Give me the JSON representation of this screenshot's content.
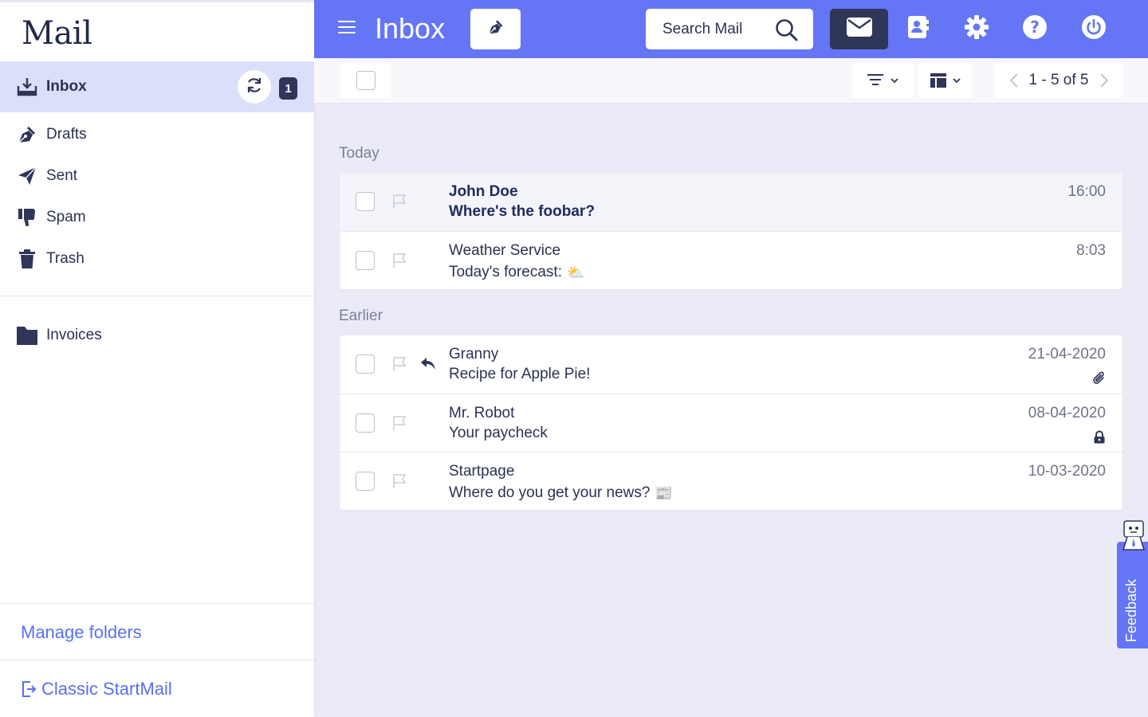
{
  "app": {
    "logo": "Mail"
  },
  "sidebar": {
    "items": [
      {
        "label": "Inbox",
        "icon": "inbox-icon",
        "unread": "1",
        "active": true
      },
      {
        "label": "Drafts",
        "icon": "drafts-pen-icon"
      },
      {
        "label": "Sent",
        "icon": "paper-plane-icon"
      },
      {
        "label": "Spam",
        "icon": "thumbs-down-icon"
      },
      {
        "label": "Trash",
        "icon": "trash-icon"
      }
    ],
    "folders": [
      {
        "label": "Invoices",
        "icon": "folder-icon"
      }
    ],
    "manage_folders": "Manage folders",
    "classic": "Classic StartMail"
  },
  "header": {
    "title": "Inbox",
    "search_label": "Search Mail"
  },
  "toolbar": {
    "pager": "1 - 5 of 5"
  },
  "groups": [
    {
      "label": "Today",
      "rows": [
        {
          "sender": "John Doe",
          "subject": "Where's the foobar?",
          "date": "16:00",
          "unread": true
        },
        {
          "sender": "Weather Service",
          "subject": "Today's forecast:",
          "date": "8:03",
          "emoji": "⛅"
        }
      ]
    },
    {
      "label": "Earlier",
      "rows": [
        {
          "sender": "Granny",
          "subject": "Recipe for Apple Pie!",
          "date": "21-04-2020",
          "replied": true,
          "attachment": true
        },
        {
          "sender": "Mr. Robot",
          "subject": "Your paycheck",
          "date": "08-04-2020",
          "encrypted": true
        },
        {
          "sender": "Startpage",
          "subject": "Where do you get your news?",
          "date": "10-03-2020",
          "emoji": "📰"
        }
      ]
    }
  ],
  "feedback": {
    "label": "Feedback"
  },
  "colors": {
    "accent": "#6476f5",
    "dark": "#2f3658",
    "active_bg": "#dcdff9",
    "link": "#5a6ff0"
  }
}
